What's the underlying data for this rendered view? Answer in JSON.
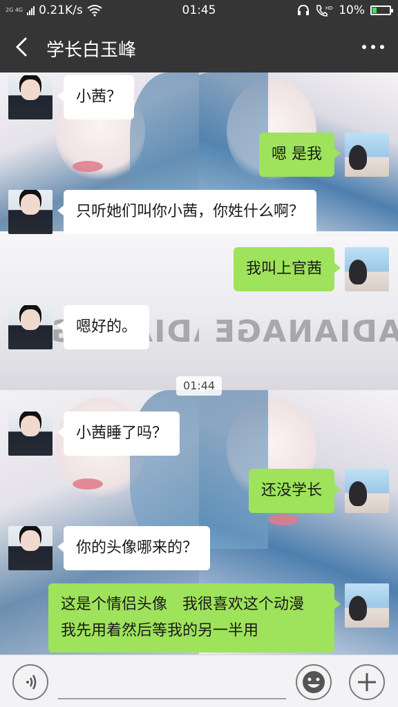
{
  "status_bar": {
    "network_label": "2G 4G",
    "speed": "0.21K/s",
    "time": "01:45",
    "battery": "10%"
  },
  "nav": {
    "title": "学长白玉峰"
  },
  "chat": {
    "timestamp": "01:44",
    "messages": [
      {
        "side": "in",
        "text": "小茜？"
      },
      {
        "side": "out",
        "text": "嗯 是我"
      },
      {
        "side": "in",
        "text": "只听她们叫你小茜，你姓什么啊？"
      },
      {
        "side": "out",
        "text": "我叫上官茜"
      },
      {
        "side": "in",
        "text": "嗯好的。"
      },
      {
        "side": "in",
        "text": "小茜睡了吗？"
      },
      {
        "side": "out",
        "text": "还没学长"
      },
      {
        "side": "in",
        "text": "你的头像哪来的？"
      },
      {
        "side": "out",
        "text": "这是个情侣头像　我很喜欢这个动漫　我先用着然后等我的另一半用"
      }
    ]
  },
  "colors": {
    "header_bg": "#353535",
    "bubble_out": "#9ee35b",
    "bubble_in": "#ffffff",
    "battery_level": "#4cd964"
  },
  "icons": {
    "back": "chevron-left-icon",
    "more": "more-dots-icon",
    "voice": "voice-icon",
    "emoji": "emoji-icon",
    "plus": "plus-icon"
  }
}
